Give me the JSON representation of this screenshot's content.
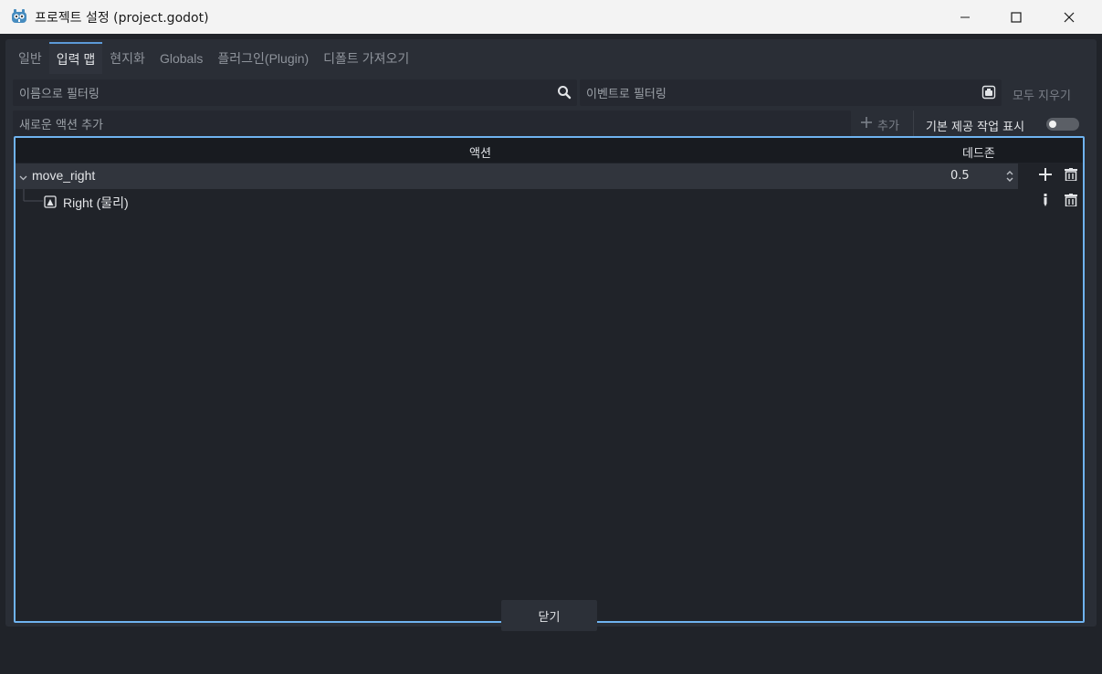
{
  "window": {
    "title": "프로젝트 설정 (project.godot)",
    "app_icon": "godot-icon",
    "controls": [
      "minimize-icon",
      "maximize-icon",
      "close-icon"
    ]
  },
  "tabs": [
    {
      "label": "일반",
      "active": false
    },
    {
      "label": "입력 맵",
      "active": true
    },
    {
      "label": "현지화",
      "active": false
    },
    {
      "label": "Globals",
      "active": false
    },
    {
      "label": "플러그인(Plugin)",
      "active": false
    },
    {
      "label": "디폴트 가져오기",
      "active": false
    }
  ],
  "filters": {
    "name_placeholder": "이름으로 필터링",
    "event_placeholder": "이벤트로 필터링",
    "clear_all": "모두 지우기"
  },
  "add_action": {
    "placeholder": "새로운 액션 추가",
    "add_label": "추가",
    "show_builtin_label": "기본 제공 작업 표시",
    "show_builtin_enabled": false
  },
  "tree": {
    "col_action": "액션",
    "col_deadzone": "데드존",
    "actions": [
      {
        "name": "move_right",
        "deadzone": "0.5",
        "expanded": true,
        "events": [
          {
            "label": "Right (물리)",
            "icon": "keyboard-key-icon"
          }
        ]
      }
    ]
  },
  "footer": {
    "close_label": "닫기"
  },
  "colors": {
    "accent": "#6fb3f0",
    "panel": "#2a2e36",
    "background": "#202329"
  }
}
